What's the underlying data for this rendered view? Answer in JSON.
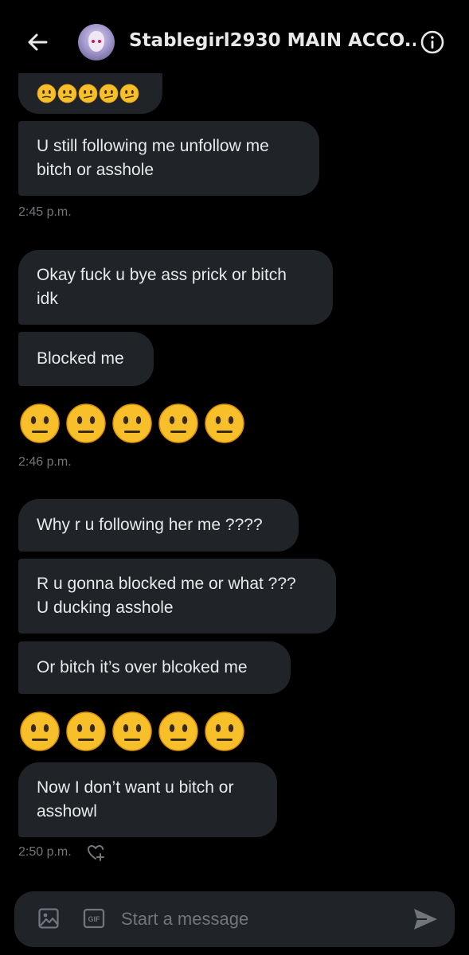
{
  "header": {
    "title": "Stablegirl2930 MAIN ACCO..."
  },
  "messages": [
    {
      "kind": "emoji",
      "emoji": "slightly-confused-faces",
      "count": 5
    },
    {
      "kind": "text",
      "lines": [
        "U still following me unfollow me",
        "bitch or asshole"
      ]
    },
    {
      "kind": "time",
      "text": "2:45 p.m."
    },
    {
      "kind": "text",
      "lines": [
        "Okay fuck u bye ass prick or bitch",
        "idk"
      ]
    },
    {
      "kind": "text",
      "lines": [
        "Blocked me"
      ]
    },
    {
      "kind": "emoji",
      "emoji": "neutral-faces",
      "count": 5
    },
    {
      "kind": "time",
      "text": "2:46 p.m."
    },
    {
      "kind": "text",
      "lines": [
        "Why r u following her me ????"
      ]
    },
    {
      "kind": "text",
      "lines": [
        "R u gonna blocked me or what ???",
        "U ducking asshole"
      ]
    },
    {
      "kind": "text",
      "lines": [
        "Or bitch it’s over blcoked me"
      ]
    },
    {
      "kind": "emoji",
      "emoji": "neutral-faces",
      "count": 5
    },
    {
      "kind": "text",
      "lines": [
        "Now I don’t want u bitch or",
        "asshowl"
      ]
    },
    {
      "kind": "time",
      "text": "2:50 p.m."
    }
  ],
  "composer": {
    "placeholder": "Start a message",
    "gif_label": "GIF"
  },
  "icons": {
    "back": "back-arrow-icon",
    "info": "info-icon",
    "image": "image-icon",
    "gif": "gif-icon",
    "send": "send-icon",
    "react": "heart-plus-icon"
  },
  "colors": {
    "background": "#000000",
    "bubble": "#202327",
    "text": "#e7e9ea",
    "muted": "#71767b",
    "accent": "#1d9bf0"
  }
}
